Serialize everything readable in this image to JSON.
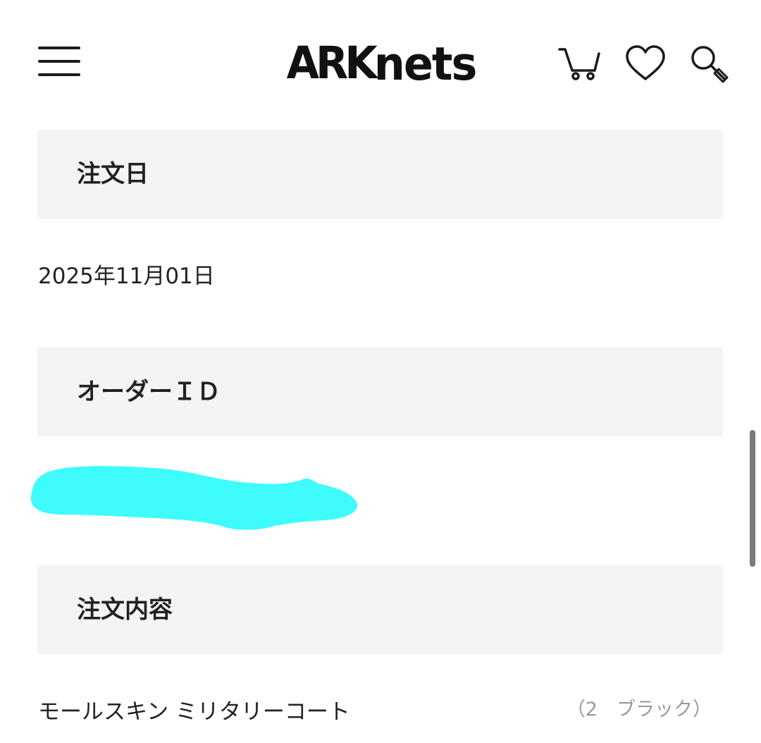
{
  "header": {
    "logo_main": "ARK",
    "logo_tail": "nets",
    "icons": {
      "menu": "hamburger-menu-icon",
      "cart": "cart-icon",
      "favorites": "heart-icon",
      "search": "search-icon"
    }
  },
  "sections": {
    "order_date": {
      "label": "注文日",
      "value": "2025年11月01日"
    },
    "order_id": {
      "label": "オーダーＩＤ"
    },
    "order_items": {
      "label": "注文内容",
      "items": [
        {
          "name": "モールスキン ミリタリーコート",
          "variant": "（2　ブラック）"
        }
      ]
    }
  },
  "colors": {
    "section_bg": "#f4f4f4",
    "redaction": "#3ffcfc",
    "text": "#222222",
    "muted": "#999999"
  }
}
